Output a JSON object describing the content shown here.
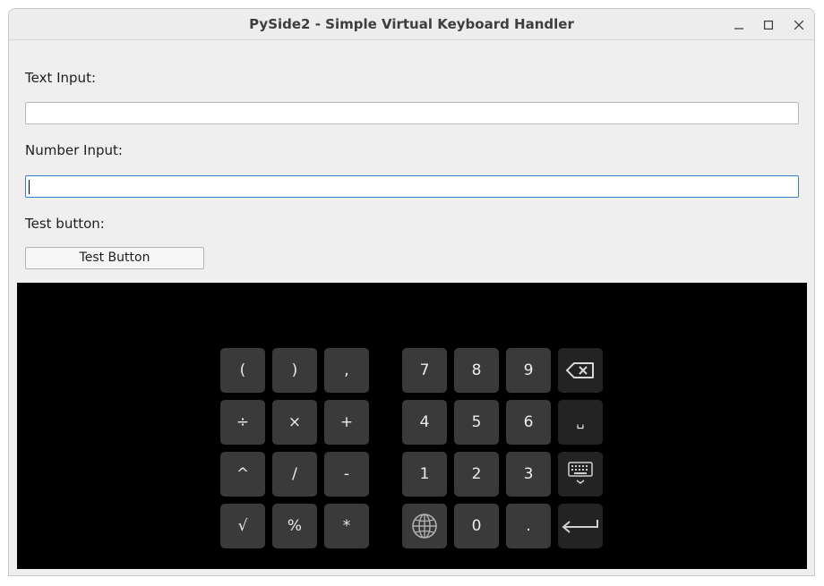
{
  "window": {
    "title": "PySide2 - Simple Virtual Keyboard Handler",
    "controls": [
      "minimize-icon",
      "maximize-icon",
      "close-icon"
    ]
  },
  "form": {
    "text_label": "Text Input:",
    "text_value": "",
    "number_label": "Number Input:",
    "number_value": "",
    "button_label": "Test button:",
    "button_text": "Test Button"
  },
  "keyboard": {
    "left_keys": [
      "(",
      ")",
      ",",
      "÷",
      "×",
      "+",
      "^",
      "/",
      "-",
      "√",
      "%",
      "*"
    ],
    "right_keys": [
      "7",
      "8",
      "9",
      "backspace-icon",
      "4",
      "5",
      "6",
      "␣",
      "1",
      "2",
      "3",
      "hide-keyboard-icon",
      "globe-icon",
      "0",
      ".",
      "enter-icon"
    ]
  },
  "colors": {
    "window_bg": "#efefef",
    "keyboard_bg": "#000000",
    "key_bg": "#3a3a3a",
    "key_special_bg": "#232323",
    "key_text": "#ececec",
    "focus_border": "#3b7dc2"
  }
}
